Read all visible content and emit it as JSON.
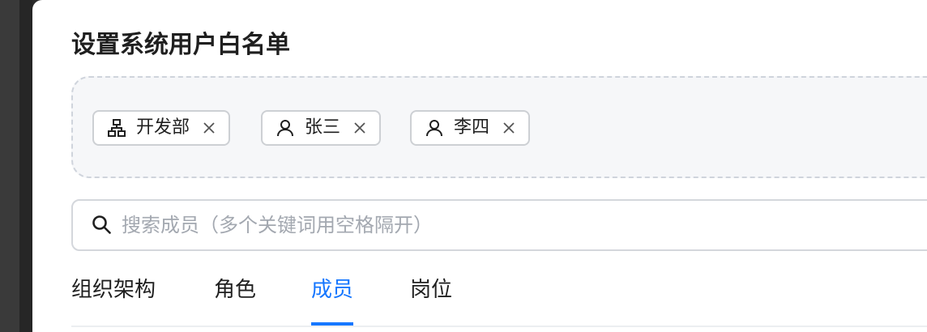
{
  "dialog": {
    "title": "设置系统用户白名单"
  },
  "selected": [
    {
      "icon": "org-icon",
      "label": "开发部"
    },
    {
      "icon": "user-icon",
      "label": "张三"
    },
    {
      "icon": "user-icon",
      "label": "李四"
    }
  ],
  "search": {
    "placeholder": "搜索成员（多个关键词用空格隔开）",
    "value": ""
  },
  "tabs": [
    {
      "label": "组织架构",
      "active": false
    },
    {
      "label": "角色",
      "active": false
    },
    {
      "label": "成员",
      "active": true
    },
    {
      "label": "岗位",
      "active": false
    }
  ],
  "colors": {
    "accent": "#1677ff"
  }
}
